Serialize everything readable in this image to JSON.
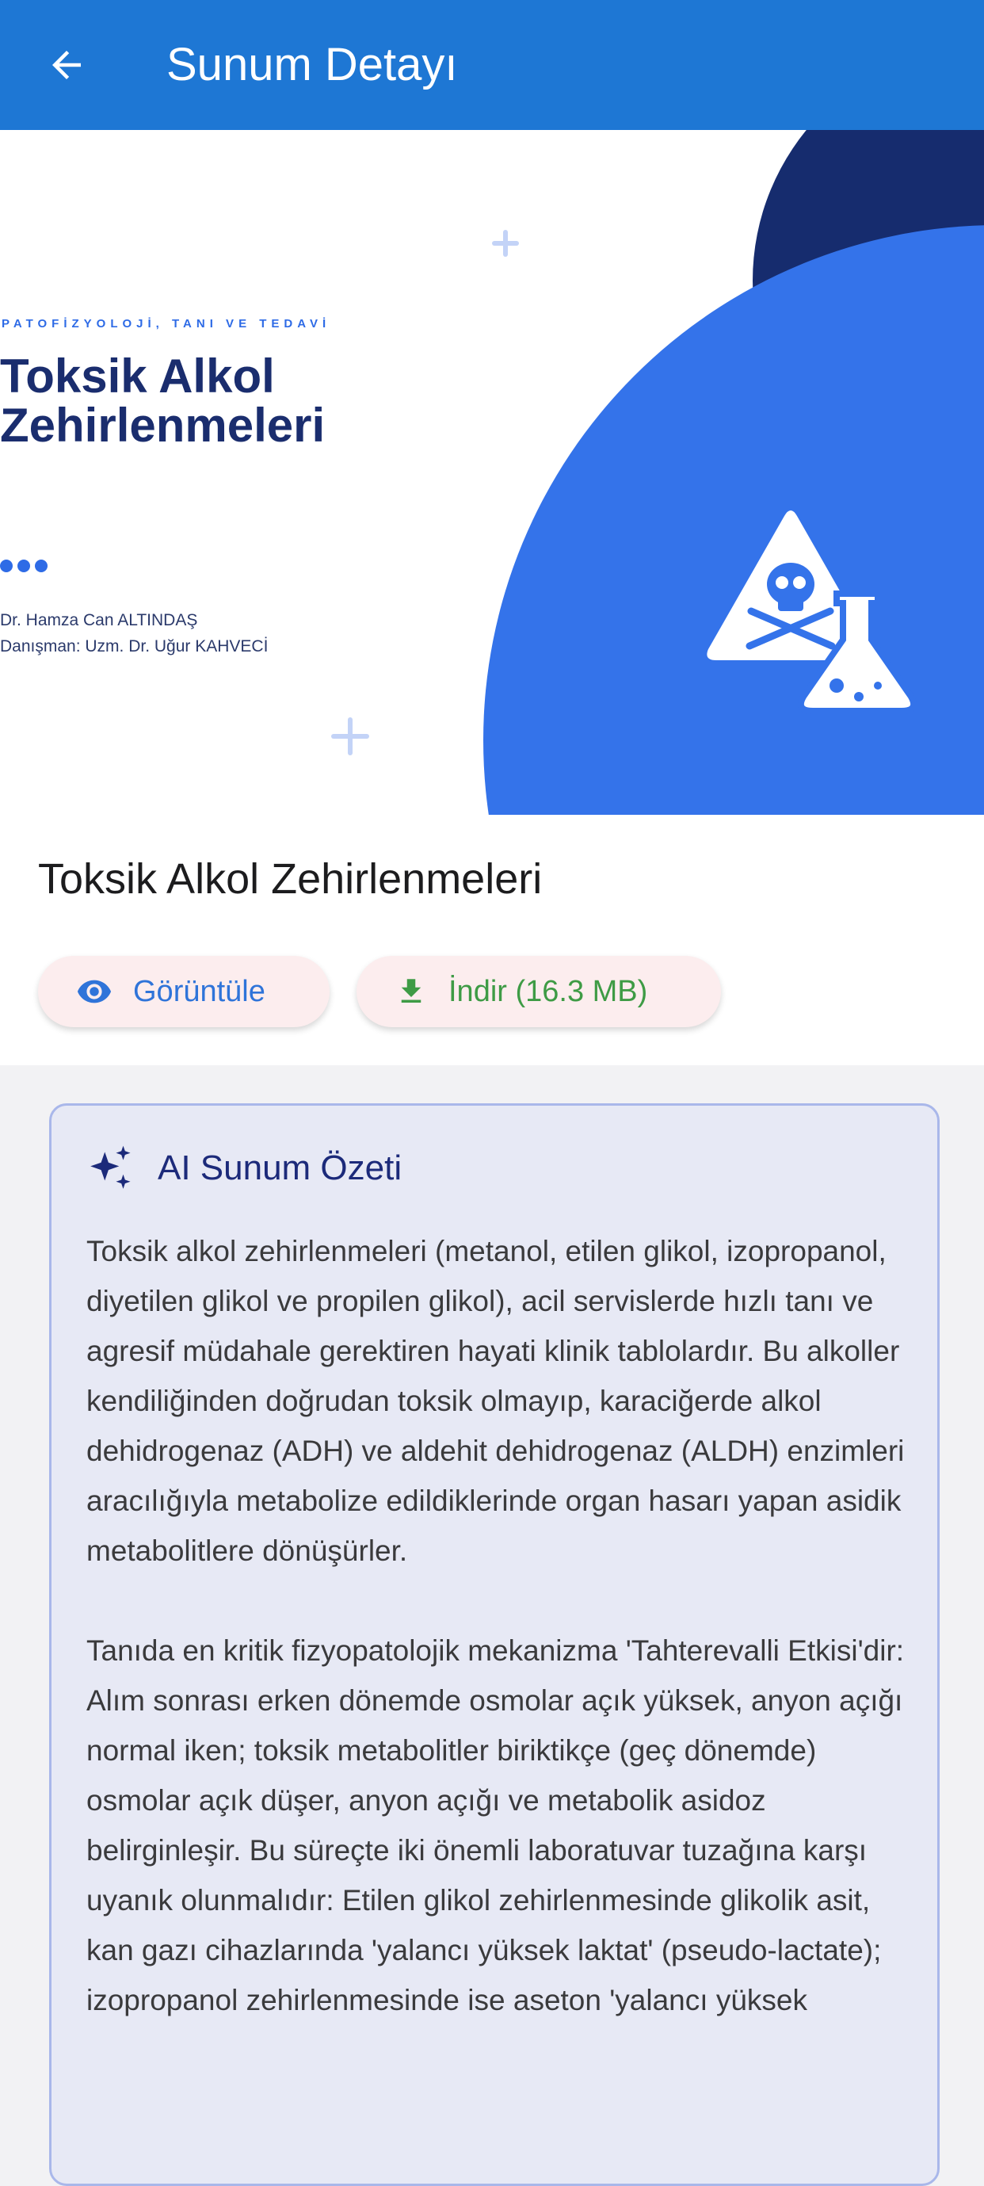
{
  "app_bar": {
    "title": "Sunum Detayı",
    "back_icon": "arrow-back-icon"
  },
  "slide": {
    "subtitle": "PATOFİZYOLOJİ, TANI VE TEDAVİ",
    "title": "Toksik Alkol Zehirlenmeleri",
    "author": "Dr. Hamza Can ALTINDAŞ",
    "advisor": "Danışman: Uzm. Dr. Uğur KAHVECİ",
    "icon": "poison-flask-icon",
    "colors": {
      "navy": "#162C6E",
      "blue": "#3473EA",
      "accent": "#2E6BE6"
    }
  },
  "presentation": {
    "title": "Toksik Alkol Zehirlenmeleri",
    "view_button": {
      "label": "Görüntüle",
      "icon": "eye-icon"
    },
    "download_button": {
      "label": "İndir (16.3 MB)",
      "icon": "download-icon"
    }
  },
  "ai_summary": {
    "icon": "sparkle-icon",
    "title": "AI Sunum Özeti",
    "paragraphs": [
      "Toksik alkol zehirlenmeleri (metanol, etilen glikol, izopropanol, diyetilen glikol ve propilen glikol), acil servislerde hızlı tanı ve agresif müdahale gerektiren hayati klinik tablolardır. Bu alkoller kendiliğinden doğrudan toksik olmayıp, karaciğerde alkol dehidrogenaz (ADH) ve aldehit dehidrogenaz (ALDH) enzimleri aracılığıyla metabolize edildiklerinde organ hasarı yapan asidik metabolitlere dönüşürler.",
      "Tanıda en kritik fizyopatolojik mekanizma 'Tahterevalli Etkisi'dir: Alım sonrası erken dönemde osmolar açık yüksek, anyon açığı normal iken; toksik metabolitler biriktikçe (geç dönemde) osmolar açık düşer, anyon açığı ve metabolik asidoz belirginleşir. Bu süreçte iki önemli laboratuvar tuzağına karşı uyanık olunmalıdır: Etilen glikol zehirlenmesinde glikolik asit, kan gazı cihazlarında 'yalancı yüksek laktat' (pseudo-lactate); izopropanol zehirlenmesinde ise aseton 'yalancı yüksek"
    ]
  }
}
